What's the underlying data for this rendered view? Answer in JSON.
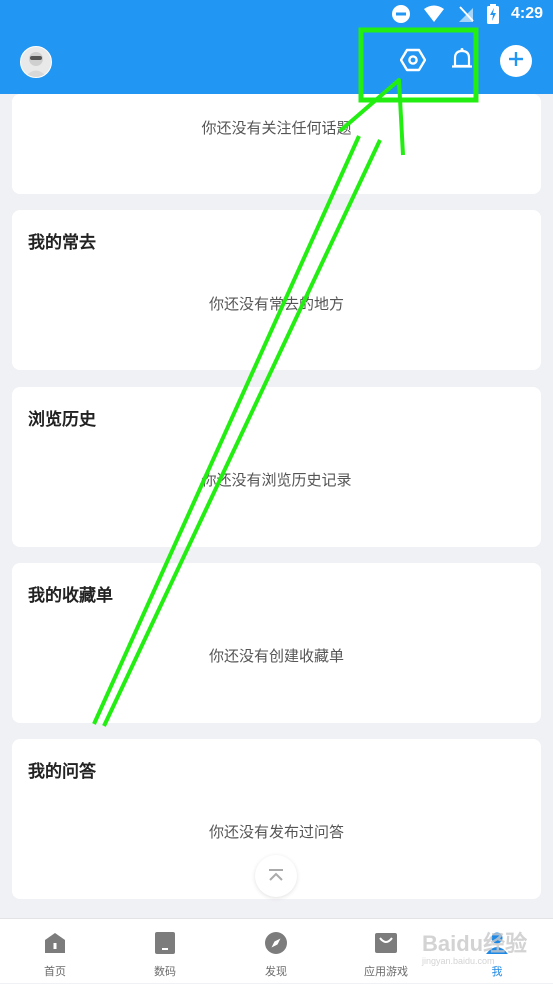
{
  "status_bar": {
    "time": "4:29"
  },
  "colors": {
    "accent": "#2196f3",
    "highlight": "#22ee11",
    "active_tab": "#1e88e5"
  },
  "cards": [
    {
      "title": "",
      "empty_text": "你还没有关注任何话题"
    },
    {
      "title": "我的常去",
      "empty_text": "你还没有常去的地方"
    },
    {
      "title": "浏览历史",
      "empty_text": "你还没有浏览历史记录"
    },
    {
      "title": "我的收藏单",
      "empty_text": "你还没有创建收藏单"
    },
    {
      "title": "我的问答",
      "empty_text": "你还没有发布过问答"
    }
  ],
  "bottom_nav": {
    "items": [
      {
        "label": "首页",
        "icon": "home-icon"
      },
      {
        "label": "数码",
        "icon": "device-icon"
      },
      {
        "label": "发现",
        "icon": "compass-icon"
      },
      {
        "label": "应用游戏",
        "icon": "bag-icon"
      },
      {
        "label": "我",
        "icon": "person-icon",
        "active": true
      }
    ]
  },
  "watermark": {
    "text": "Baidu经验",
    "subtext": "jingyan.baidu.com"
  }
}
